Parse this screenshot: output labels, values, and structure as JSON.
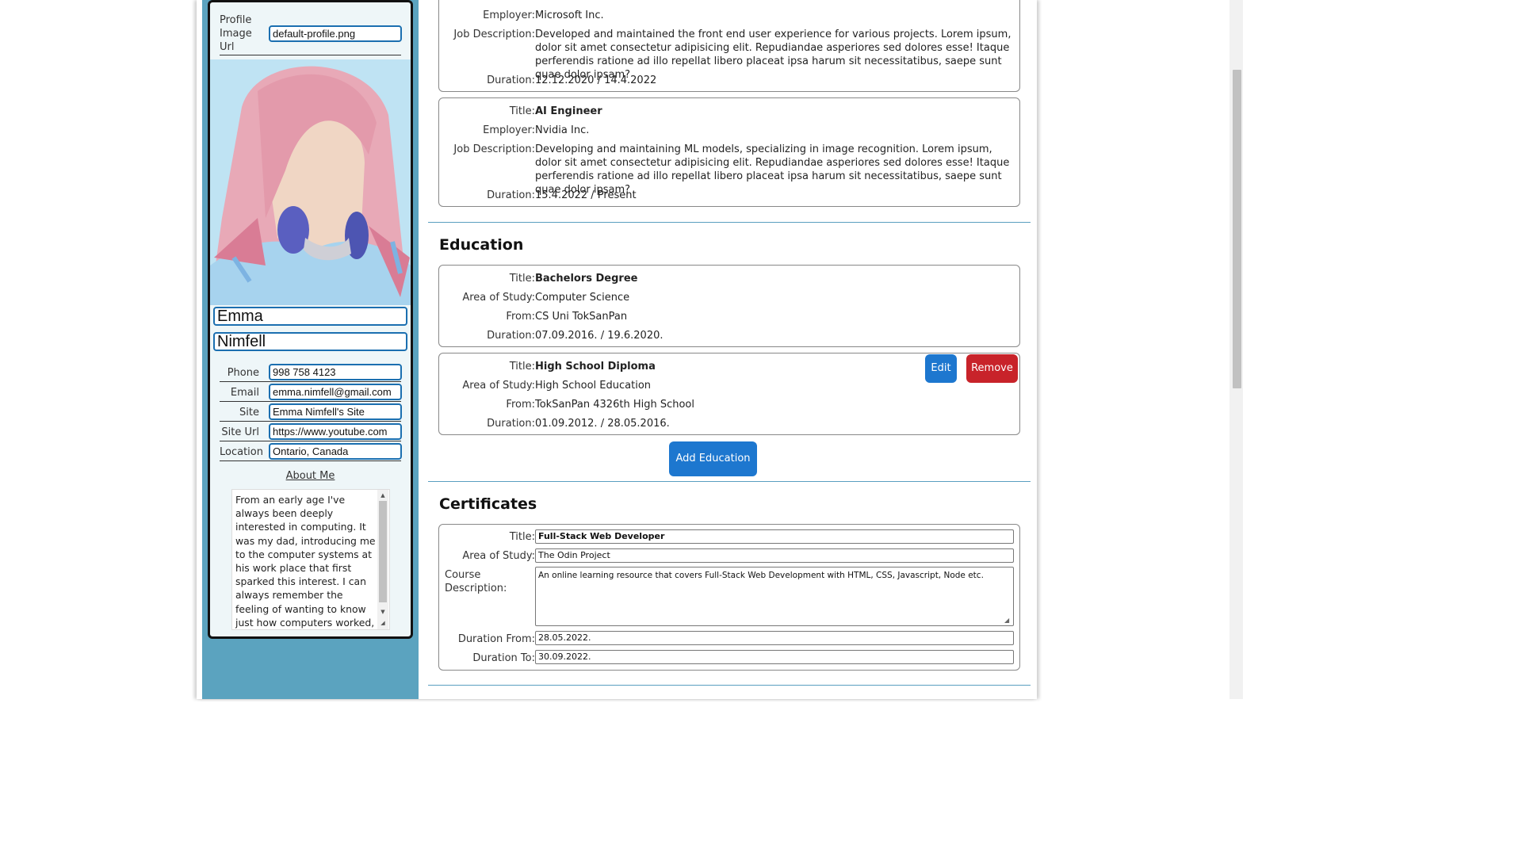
{
  "profile": {
    "image_url_label": "Profile Image Url",
    "image_url_value": "default-profile.png",
    "first_name": "Emma",
    "last_name": "Nimfell",
    "fields": [
      {
        "label": "Phone",
        "value": "998 758 4123"
      },
      {
        "label": "Email",
        "value": "emma.nimfell@gmail.com"
      },
      {
        "label": "Site",
        "value": "Emma Nimfell's Site"
      },
      {
        "label": "Site Url",
        "value": "https://www.youtube.com"
      },
      {
        "label": "Location",
        "value": "Ontario, Canada"
      }
    ],
    "about_title": "About Me",
    "about_text": "From an early age I've always been deeply interested in computing. It was my dad, introducing me to the computer systems at his work place that first sparked this interest. I can always remember the feeling of wanting to know just how computers worked, why they"
  },
  "experience": [
    {
      "employer_label": "Employer:",
      "employer": "Microsoft Inc.",
      "desc_label": "Job Description:",
      "desc": "Developed and maintained the front end user experience for various projects. Lorem ipsum, dolor sit amet consectetur adipisicing elit. Repudiandae asperiores sed dolores esse! Itaque perferendis ratione ad illo repellat libero placeat ipsa harum sit necessitatibus, saepe sunt quae dolor ipsam?",
      "duration_label": "Duration:",
      "duration": "12.12.2020 / 14.4.2022"
    },
    {
      "title_label": "Title:",
      "title": "AI Engineer",
      "employer_label": "Employer:",
      "employer": "Nvidia Inc.",
      "desc_label": "Job Description:",
      "desc": "Developing and maintaining ML models, specializing in image recognition. Lorem ipsum, dolor sit amet consectetur adipisicing elit. Repudiandae asperiores sed dolores esse! Itaque perferendis ratione ad illo repellat libero placeat ipsa harum sit necessitatibus, saepe sunt quae dolor ipsam?",
      "duration_label": "Duration:",
      "duration": "15.4.2022 / Present"
    }
  ],
  "education": {
    "heading": "Education",
    "entries": [
      {
        "title": "Bachelors Degree",
        "area": "Computer Science",
        "from": "CS Uni TokSanPan",
        "duration": "07.09.2016. / 19.6.2020."
      },
      {
        "title": "High School Diploma",
        "area": "High School Education",
        "from": "TokSanPan 4326th High School",
        "duration": "01.09.2012. / 28.05.2016."
      }
    ],
    "labels": {
      "title": "Title:",
      "area": "Area of Study:",
      "from": "From:",
      "duration": "Duration:"
    },
    "edit_label": "Edit",
    "remove_label": "Remove",
    "add_label": "Add Education"
  },
  "certificates": {
    "heading": "Certificates",
    "labels": {
      "title": "Title:",
      "area": "Area of Study:",
      "desc": "Course Description:",
      "from": "Duration From:",
      "to": "Duration To:"
    },
    "title": "Full-Stack Web Developer",
    "area": "The Odin Project",
    "desc": "An online learning resource that covers Full-Stack Web Development with HTML, CSS, Javascript, Node etc.",
    "from": "28.05.2022.",
    "to": "30.09.2022."
  },
  "colors": {
    "sidebar": "#5ba3bf",
    "accent_blue": "#1d77cf",
    "danger_red": "#c8232a",
    "separator": "#5a9fc0"
  }
}
